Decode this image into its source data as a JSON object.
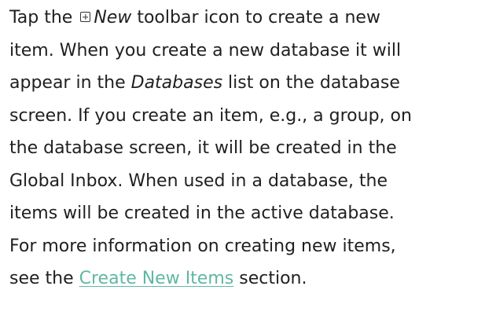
{
  "help": {
    "line1": {
      "before_icon": "Tap the ",
      "icon": "plus-square-icon",
      "new_label": "New",
      "after_new": " toolbar icon to create a new"
    },
    "line2": "item. When you create a new database it will",
    "line3": {
      "before": "appear in the ",
      "databases_label": "Databases",
      "after": " list on the database"
    },
    "line4": "screen. If you create an item, e.g., a group, on",
    "line5": "the database screen, it will be created in the",
    "line6": "Global Inbox. When used in a database, the",
    "line7": "items will be created in the active database.",
    "line8": "For more information on creating new items,",
    "line9": {
      "before_link": "see the ",
      "link_text": "Create New Items",
      "after_link": " section."
    }
  },
  "colors": {
    "text": "#1f1f1f",
    "link": "#5fb7a3"
  }
}
